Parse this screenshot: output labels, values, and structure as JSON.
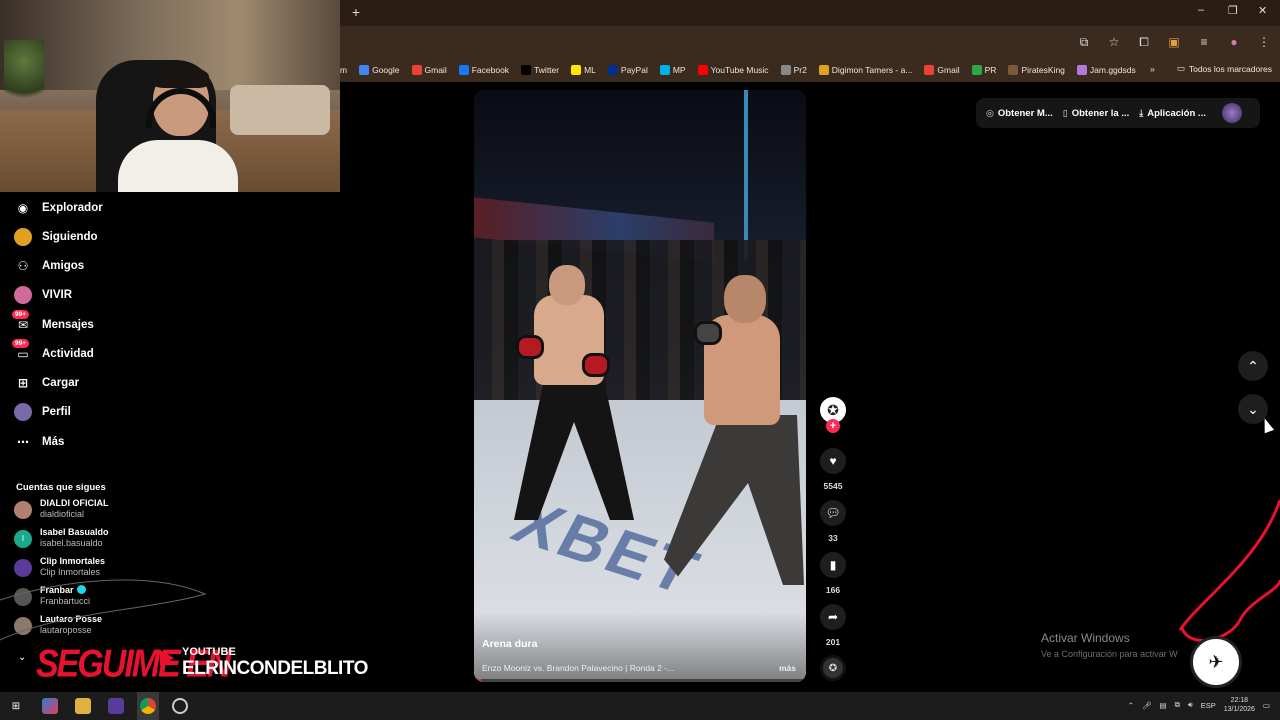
{
  "browser": {
    "new_tab": "+",
    "window_controls": [
      "–",
      "❐",
      "✕"
    ],
    "bookmarks": [
      {
        "label": "m",
        "icon": "",
        "color": "#3b2a1e"
      },
      {
        "label": "Google",
        "icon": "google-icon",
        "color": "#4285f4"
      },
      {
        "label": "Gmail",
        "icon": "gmail-icon",
        "color": "#ea4335"
      },
      {
        "label": "Facebook",
        "icon": "facebook-icon",
        "color": "#1877f2"
      },
      {
        "label": "Twitter",
        "icon": "x-icon",
        "color": "#000000"
      },
      {
        "label": "ML",
        "icon": "mercadolibre-icon",
        "color": "#ffe600"
      },
      {
        "label": "PayPal",
        "icon": "paypal-icon",
        "color": "#003087"
      },
      {
        "label": "MP",
        "icon": "mercadopago-icon",
        "color": "#00b1ea"
      },
      {
        "label": "YouTube Music",
        "icon": "youtube-music-icon",
        "color": "#ff0000"
      },
      {
        "label": "Pr2",
        "icon": "link-icon",
        "color": "#888888"
      },
      {
        "label": "Digimon Tamers - a...",
        "icon": "digimon-icon",
        "color": "#e0a020"
      },
      {
        "label": "Gmail",
        "icon": "gmail-icon",
        "color": "#ea4335"
      },
      {
        "label": "PR",
        "icon": "pr-icon",
        "color": "#2aa84a"
      },
      {
        "label": "PiratesKing",
        "icon": "piratesking-icon",
        "color": "#7a5a3a"
      },
      {
        "label": "Jam.ggdsds",
        "icon": "jam-icon",
        "color": "#b07ad8"
      }
    ],
    "bookmarks_more": "»",
    "all_bookmarks": "Todos los marcadores"
  },
  "sidebar": {
    "nav": [
      {
        "label": "Explorador",
        "icon": "compass-icon"
      },
      {
        "label": "Siguiendo",
        "icon": "following-avatar-icon"
      },
      {
        "label": "Amigos",
        "icon": "friends-icon"
      },
      {
        "label": "VIVIR",
        "icon": "live-avatar-icon"
      },
      {
        "label": "Mensajes",
        "icon": "messages-icon",
        "badge": "99+"
      },
      {
        "label": "Actividad",
        "icon": "activity-icon",
        "badge": "99+"
      },
      {
        "label": "Cargar",
        "icon": "upload-icon"
      },
      {
        "label": "Perfil",
        "icon": "profile-avatar-icon"
      },
      {
        "label": "Más",
        "icon": "more-icon"
      }
    ],
    "following_title": "Cuentas que sigues",
    "accounts": [
      {
        "name": "DIALDI OFICIAL",
        "handle": "dialdioficial",
        "color": "#b08070"
      },
      {
        "name": "Isabel Basualdo",
        "handle": "isabel.basualdo",
        "color": "#19a98c",
        "initial": "I"
      },
      {
        "name": "Clip Inmortales",
        "handle": "Clip Inmortales",
        "color": "#5a3a9a"
      },
      {
        "name": "Franbar",
        "handle": "Franbartucci",
        "color": "#555555",
        "verified": true
      },
      {
        "name": "Lautaro Posse",
        "handle": "lautaroposse",
        "color": "#8a7a6a"
      }
    ],
    "collapse": "⌄"
  },
  "overlay_banner": {
    "call": "SEGUIME EN",
    "platform": "YOUTUBE",
    "channel": "ELRINCONDELBLITO"
  },
  "video": {
    "author": "Arena dura",
    "description": "Enzo Mooniz vs. Brandon Palavecino | Ronda 2 -...",
    "more": "más",
    "progress": 0.02,
    "floor_logo": "XBET"
  },
  "actions": {
    "follow_plus": "+",
    "likes": "5545",
    "comments": "33",
    "saves": "166",
    "shares": "201"
  },
  "topbar": {
    "coins": "Obtener M...",
    "app_get": "Obtener la ...",
    "app": "Aplicación ..."
  },
  "watermark": {
    "line1": "Activar Windows",
    "line2": "Ve a Configuración para activar W"
  },
  "taskbar": {
    "lang": "ESP",
    "time": "22:18",
    "date": "13/1/2026"
  },
  "colors": {
    "accent": "#fe2c55",
    "banner_red": "#e8122f",
    "browser_bar": "#3b2a1e"
  }
}
